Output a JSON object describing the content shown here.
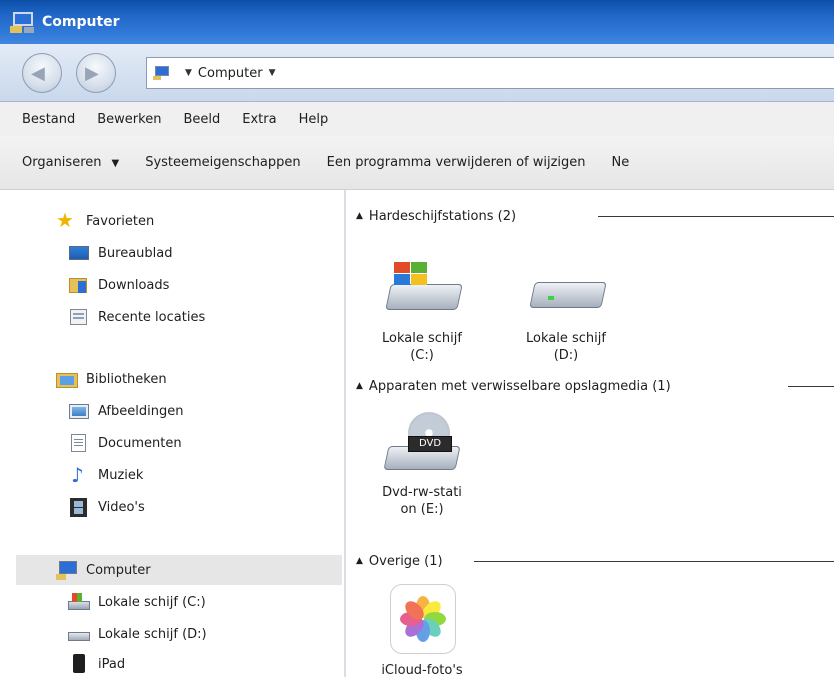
{
  "window": {
    "title": "Computer"
  },
  "address": {
    "crumb": "Computer"
  },
  "menu": [
    "Bestand",
    "Bewerken",
    "Beeld",
    "Extra",
    "Help"
  ],
  "commands": {
    "organize": "Organiseren",
    "system_props": "Systeemeigenschappen",
    "uninstall": "Een programma verwijderen of wijzigen",
    "more": "Ne"
  },
  "sidebar": {
    "favorites": {
      "label": "Favorieten",
      "items": [
        "Bureaublad",
        "Downloads",
        "Recente locaties"
      ]
    },
    "libraries": {
      "label": "Bibliotheken",
      "items": [
        "Afbeeldingen",
        "Documenten",
        "Muziek",
        "Video's"
      ]
    },
    "computer": {
      "label": "Computer",
      "items": [
        "Lokale schijf (C:)",
        "Lokale schijf (D:)",
        "iPad"
      ]
    }
  },
  "groups": {
    "hdd": {
      "label": "Hardeschijfstations (2)",
      "tiles": [
        {
          "line1": "Lokale schijf",
          "line2": "(C:)"
        },
        {
          "line1": "Lokale schijf",
          "line2": "(D:)"
        }
      ]
    },
    "removable": {
      "label": "Apparaten met verwisselbare opslagmedia (1)",
      "tiles": [
        {
          "line1": "Dvd-rw-stati",
          "line2": "on (E:)",
          "badge": "DVD"
        }
      ]
    },
    "other": {
      "label": "Overige (1)",
      "tiles": [
        {
          "line1": "iCloud-foto's"
        }
      ]
    }
  },
  "colors": {
    "titlebar": "#1e64c4",
    "selection": "#e6e6e6"
  }
}
